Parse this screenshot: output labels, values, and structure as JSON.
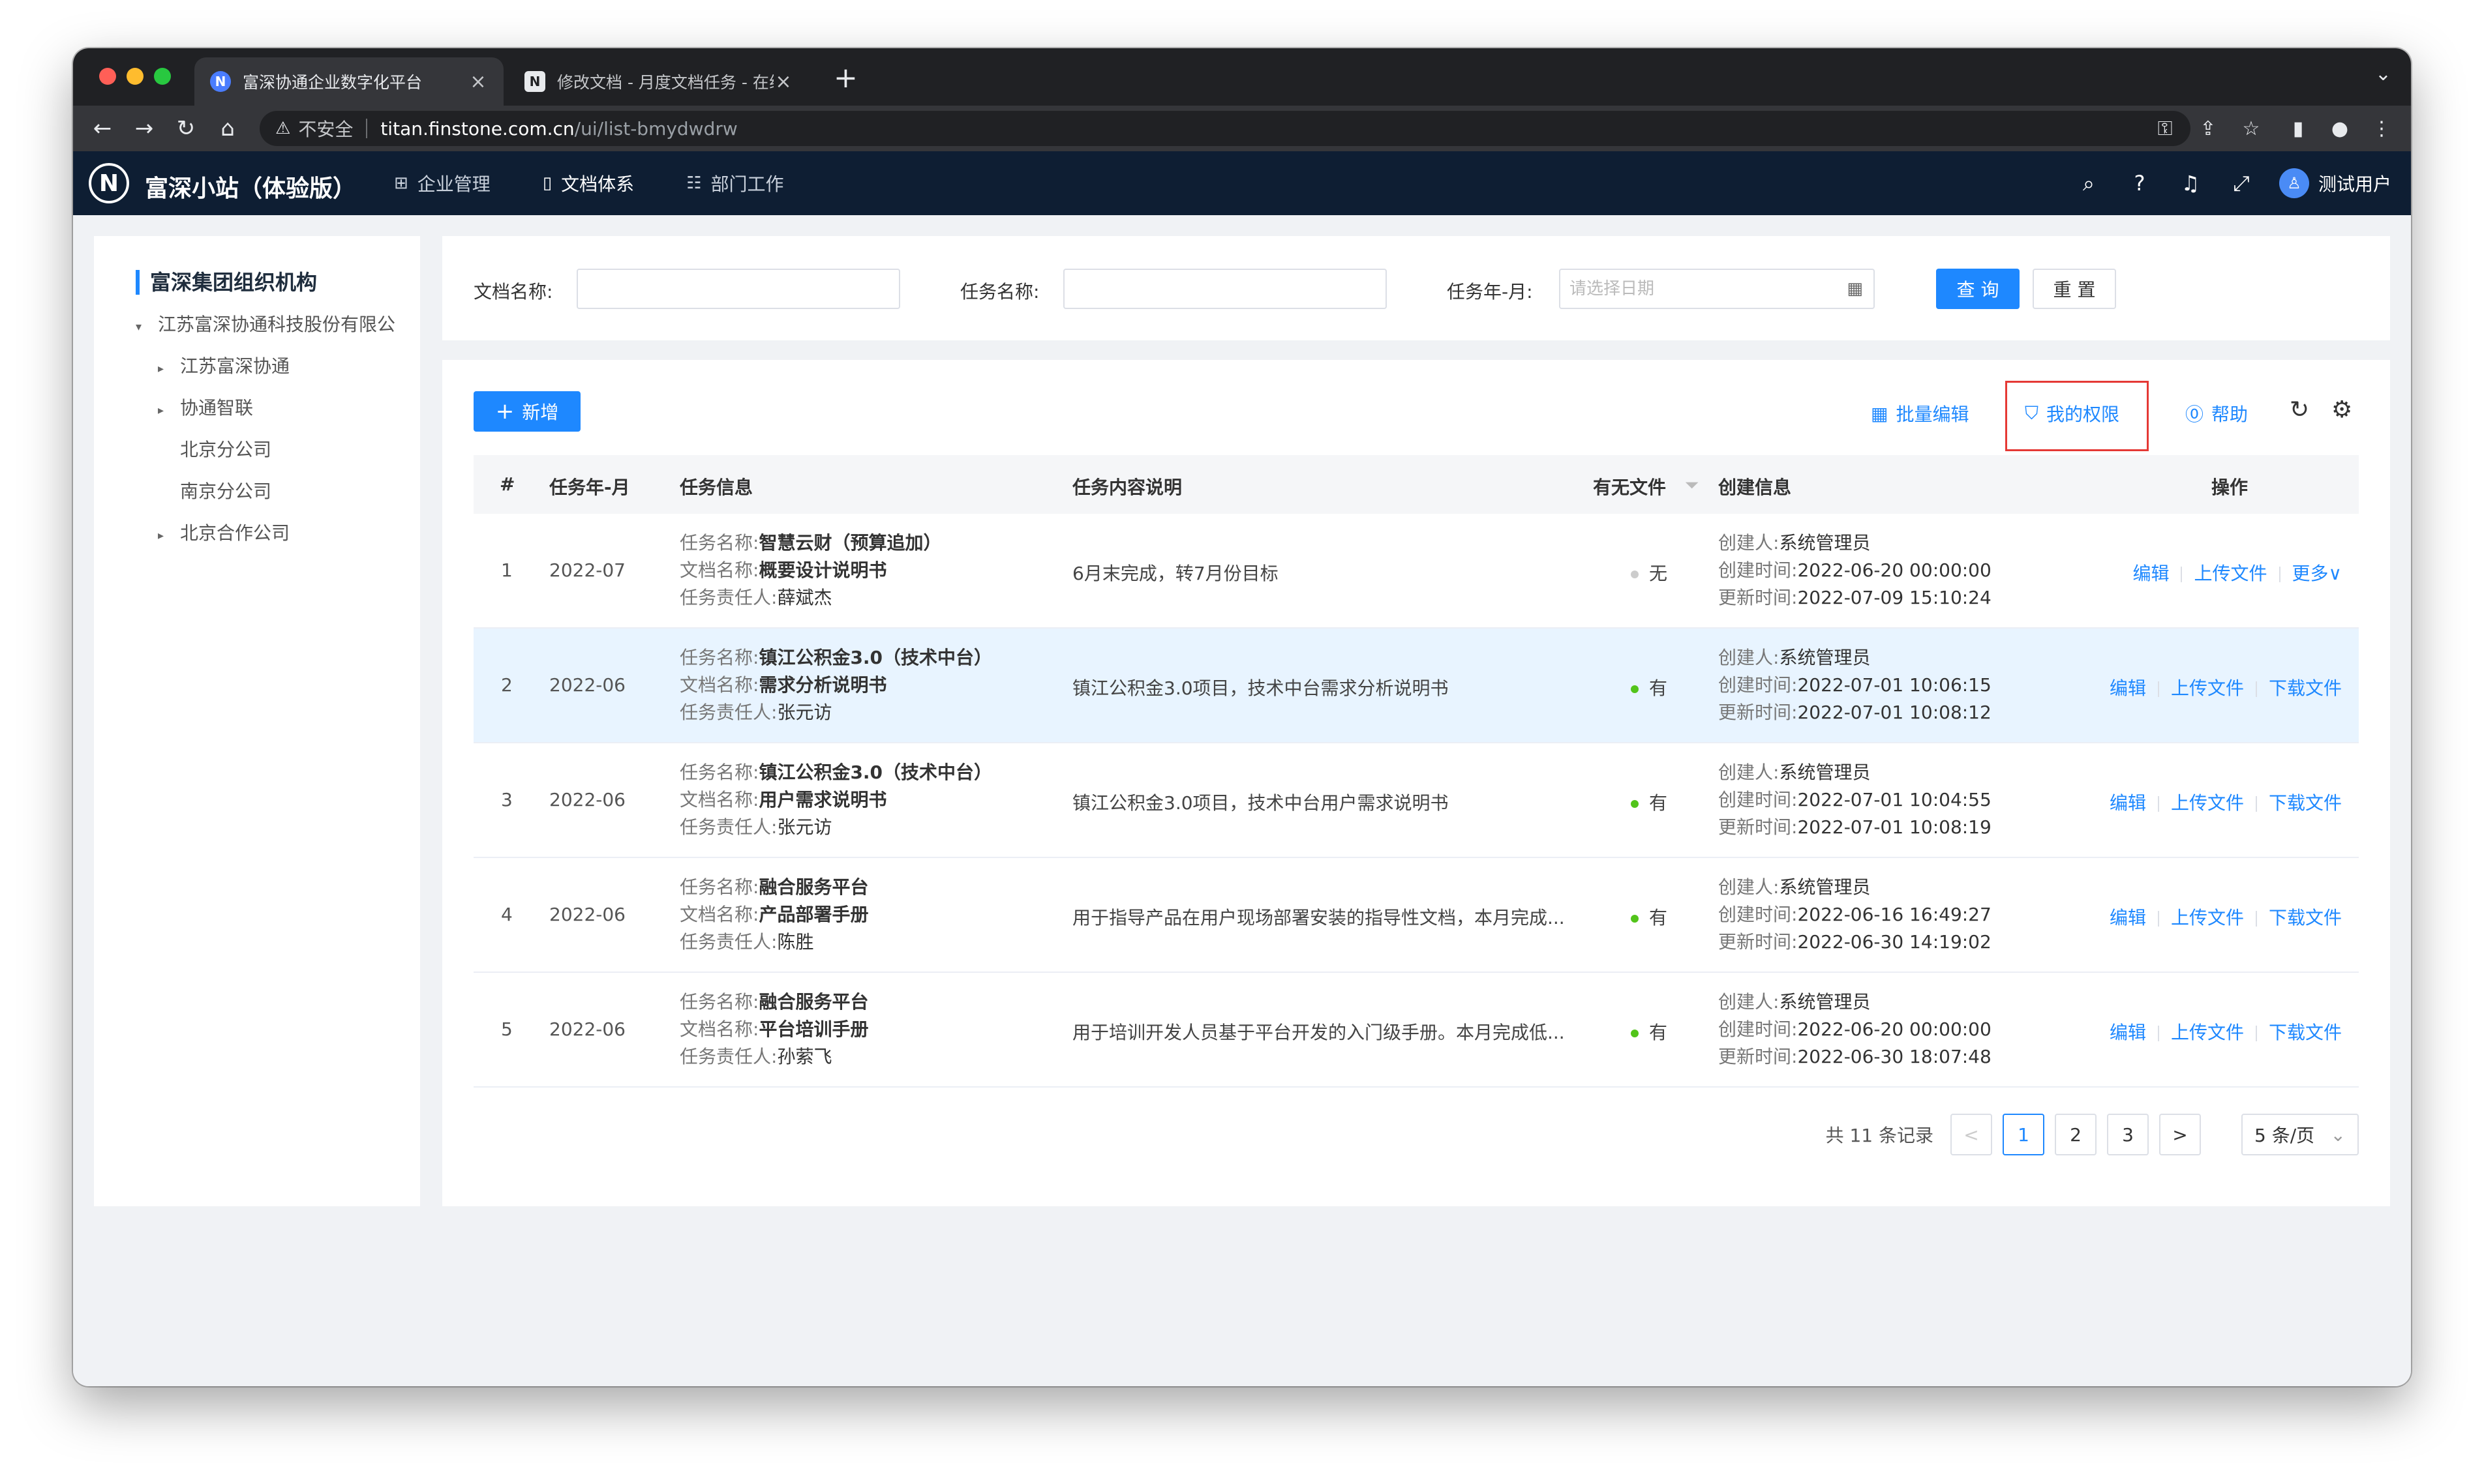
{
  "browser": {
    "tabs": [
      {
        "title": "富深协通企业数字化平台",
        "favicon": "N",
        "close": "×"
      },
      {
        "title": "修改文档 - 月度文档任务 - 在线",
        "favicon": "N",
        "close": "×"
      }
    ],
    "new_tab": "+",
    "address": {
      "insecure_label": "不安全",
      "host": "titan.finstone.com.cn",
      "path": "/ui/list-bmydwdrw"
    }
  },
  "app": {
    "logo": "N",
    "brand": "富深小站（体验版）",
    "nav": [
      {
        "label": "企业管理",
        "icon": "grid-icon"
      },
      {
        "label": "文档体系",
        "icon": "document-icon"
      },
      {
        "label": "部门工作",
        "icon": "table-icon"
      }
    ],
    "user": "测试用户"
  },
  "sidebar": {
    "title": "富深集团组织机构",
    "items": [
      {
        "label": "江苏富深协通科技股份有限公",
        "caret": "▾"
      },
      {
        "label": "江苏富深协通",
        "caret": "▸"
      },
      {
        "label": "协通智联",
        "caret": "▸"
      },
      {
        "label": "北京分公司",
        "caret": ""
      },
      {
        "label": "南京分公司",
        "caret": ""
      },
      {
        "label": "北京合作公司",
        "caret": "▸"
      }
    ]
  },
  "filters": {
    "doc_name_label": "文档名称:",
    "task_name_label": "任务名称:",
    "month_label": "任务年-月:",
    "date_placeholder": "请选择日期",
    "query": "查 询",
    "reset": "重 置"
  },
  "toolbar": {
    "add": "新增",
    "batch_edit": "批量编辑",
    "my_permissions": "我的权限",
    "help": "帮助"
  },
  "table": {
    "headers": [
      "#",
      "任务年-月",
      "任务信息",
      "任务内容说明",
      "有无文件",
      "创建信息",
      "操作"
    ],
    "task_label": "任务名称:",
    "doc_label": "文档名称:",
    "owner_label": "任务责任人:",
    "creator_label": "创建人:",
    "created_label": "创建时间:",
    "updated_label": "更新时间:",
    "rows": [
      {
        "idx": "1",
        "month": "2022-07",
        "task": "智慧云财（预算追加）",
        "doc": "概要设计说明书",
        "owner": "薛斌杰",
        "desc": "6月末完成，转7月份目标",
        "file": "无",
        "has_file": false,
        "creator": "系统管理员",
        "created": "2022-06-20 00:00:00",
        "updated": "2022-07-09 15:10:24",
        "ops": [
          "编辑",
          "上传文件",
          "更多∨"
        ]
      },
      {
        "idx": "2",
        "month": "2022-06",
        "task": "镇江公积金3.0（技术中台）",
        "doc": "需求分析说明书",
        "owner": "张元访",
        "desc": "镇江公积金3.0项目，技术中台需求分析说明书",
        "file": "有",
        "has_file": true,
        "creator": "系统管理员",
        "created": "2022-07-01 10:06:15",
        "updated": "2022-07-01 10:08:12",
        "ops": [
          "编辑",
          "上传文件",
          "下载文件"
        ]
      },
      {
        "idx": "3",
        "month": "2022-06",
        "task": "镇江公积金3.0（技术中台）",
        "doc": "用户需求说明书",
        "owner": "张元访",
        "desc": "镇江公积金3.0项目，技术中台用户需求说明书",
        "file": "有",
        "has_file": true,
        "creator": "系统管理员",
        "created": "2022-07-01 10:04:55",
        "updated": "2022-07-01 10:08:19",
        "ops": [
          "编辑",
          "上传文件",
          "下载文件"
        ]
      },
      {
        "idx": "4",
        "month": "2022-06",
        "task": "融合服务平台",
        "doc": "产品部署手册",
        "owner": "陈胜",
        "desc": "用于指导产品在用户现场部署安装的指导性文档，本月完成...",
        "file": "有",
        "has_file": true,
        "creator": "系统管理员",
        "created": "2022-06-16 16:49:27",
        "updated": "2022-06-30 14:19:02",
        "ops": [
          "编辑",
          "上传文件",
          "下载文件"
        ]
      },
      {
        "idx": "5",
        "month": "2022-06",
        "task": "融合服务平台",
        "doc": "平台培训手册",
        "owner": "孙萦飞",
        "desc": "用于培训开发人员基于平台开发的入门级手册。本月完成低...",
        "file": "有",
        "has_file": true,
        "creator": "系统管理员",
        "created": "2022-06-20 00:00:00",
        "updated": "2022-06-30 18:07:48",
        "ops": [
          "编辑",
          "上传文件",
          "下载文件"
        ]
      }
    ]
  },
  "pagination": {
    "total": "共 11 条记录",
    "prev": "<",
    "pages": [
      "1",
      "2",
      "3"
    ],
    "current": "1",
    "next": ">",
    "page_size": "5 条/页"
  }
}
